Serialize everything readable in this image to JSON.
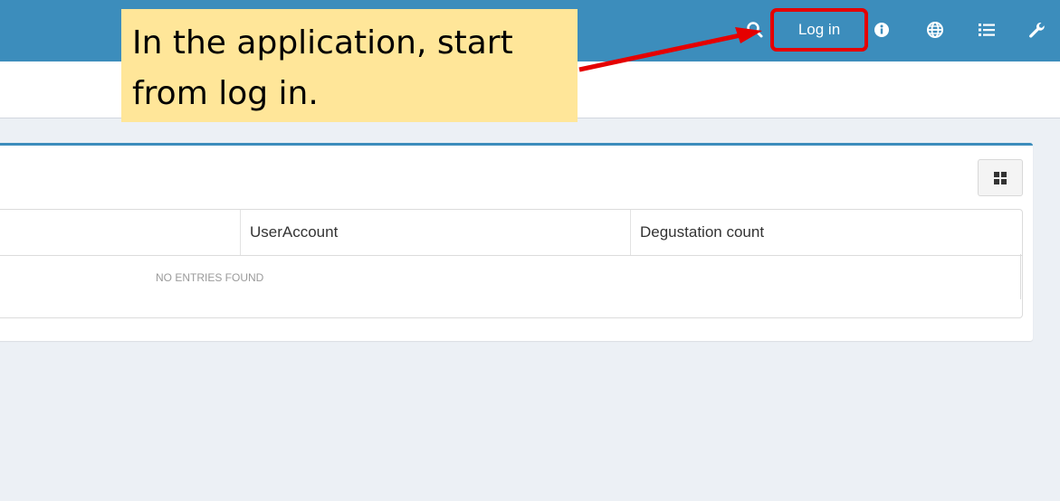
{
  "header": {
    "login_label": "Log in",
    "icons": [
      "search-icon",
      "info-icon",
      "globe-icon",
      "list-icon",
      "wrench-icon"
    ],
    "bar_color": "#3c8dbc"
  },
  "callout": {
    "line1": "In the application, start",
    "line2": "from log in.",
    "background": "#ffe699"
  },
  "table": {
    "columns": [
      "UserAccount",
      "Degustation count"
    ],
    "empty_message": "NO ENTRIES FOUND"
  },
  "colors": {
    "highlight": "#e50000",
    "page_bg": "#ecf0f5"
  }
}
